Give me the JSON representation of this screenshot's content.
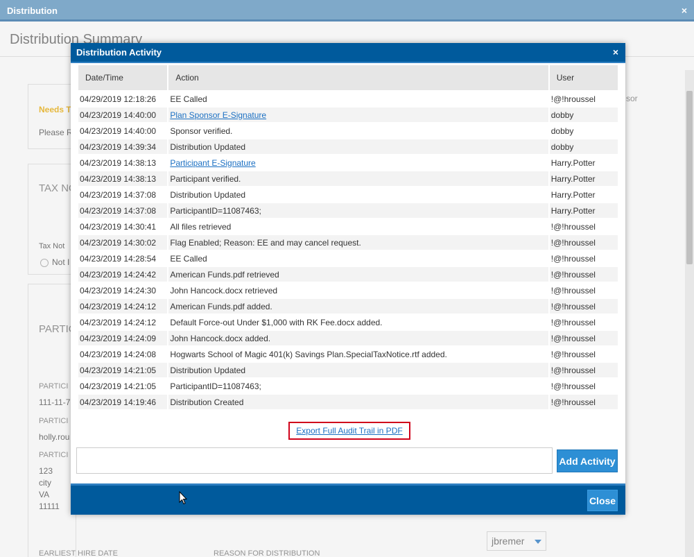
{
  "window": {
    "title": "Distribution",
    "close_icon": "×"
  },
  "background": {
    "summary_title": "Distribution Summary",
    "needs_text": "Needs T",
    "please_text": "Please R",
    "tax_notice_head": "TAX NO",
    "tax_notice_label": "Tax Not",
    "not_label": "Not I",
    "partic_head": "PARTIC",
    "partic_label_1": "PARTICI",
    "ssn_value": "111-11-7",
    "partic_label_2": "PARTICI",
    "email_value": "holly.rou",
    "partic_label_3": "PARTICI",
    "address_line1": "123",
    "address_line2": "city",
    "address_line3": "VA",
    "address_line4": "11111",
    "earliest_hire": "EARLIEST HIRE DATE",
    "reason_for": "REASON FOR DISTRIBUTION",
    "right_snippet": "sor",
    "assignee": "jbremer"
  },
  "modal": {
    "title": "Distribution Activity",
    "close_icon": "×",
    "columns": [
      "Date/Time",
      "Action",
      "User"
    ],
    "rows": [
      {
        "datetime": "04/29/2019 12:18:26",
        "action": "EE Called",
        "user": "!@!hroussel",
        "link": false
      },
      {
        "datetime": "04/23/2019 14:40:00",
        "action": "Plan Sponsor E-Signature",
        "user": "dobby",
        "link": true
      },
      {
        "datetime": "04/23/2019 14:40:00",
        "action": "Sponsor verified.",
        "user": "dobby",
        "link": false
      },
      {
        "datetime": "04/23/2019 14:39:34",
        "action": "Distribution Updated",
        "user": "dobby",
        "link": false
      },
      {
        "datetime": "04/23/2019 14:38:13",
        "action": "Participant E-Signature",
        "user": "Harry.Potter",
        "link": true
      },
      {
        "datetime": "04/23/2019 14:38:13",
        "action": "Participant verified.",
        "user": "Harry.Potter",
        "link": false
      },
      {
        "datetime": "04/23/2019 14:37:08",
        "action": "Distribution Updated",
        "user": "Harry.Potter",
        "link": false
      },
      {
        "datetime": "04/23/2019 14:37:08",
        "action": "ParticipantID=11087463;",
        "user": "Harry.Potter",
        "link": false
      },
      {
        "datetime": "04/23/2019 14:30:41",
        "action": "All files retrieved",
        "user": "!@!hroussel",
        "link": false
      },
      {
        "datetime": "04/23/2019 14:30:02",
        "action": "Flag Enabled; Reason: EE and may cancel request.",
        "user": "!@!hroussel",
        "link": false
      },
      {
        "datetime": "04/23/2019 14:28:54",
        "action": "EE Called",
        "user": "!@!hroussel",
        "link": false
      },
      {
        "datetime": "04/23/2019 14:24:42",
        "action": "American Funds.pdf retrieved",
        "user": "!@!hroussel",
        "link": false
      },
      {
        "datetime": "04/23/2019 14:24:30",
        "action": "John Hancock.docx retrieved",
        "user": "!@!hroussel",
        "link": false
      },
      {
        "datetime": "04/23/2019 14:24:12",
        "action": "American Funds.pdf added.",
        "user": "!@!hroussel",
        "link": false
      },
      {
        "datetime": "04/23/2019 14:24:12",
        "action": "Default Force-out Under $1,000 with RK Fee.docx added.",
        "user": "!@!hroussel",
        "link": false
      },
      {
        "datetime": "04/23/2019 14:24:09",
        "action": "John Hancock.docx added.",
        "user": "!@!hroussel",
        "link": false
      },
      {
        "datetime": "04/23/2019 14:24:08",
        "action": "Hogwarts School of Magic 401(k) Savings Plan.SpecialTaxNotice.rtf added.",
        "user": "!@!hroussel",
        "link": false
      },
      {
        "datetime": "04/23/2019 14:21:05",
        "action": "Distribution Updated",
        "user": "!@!hroussel",
        "link": false
      },
      {
        "datetime": "04/23/2019 14:21:05",
        "action": "ParticipantID=11087463;",
        "user": "!@!hroussel",
        "link": false
      },
      {
        "datetime": "04/23/2019 14:19:46",
        "action": "Distribution Created",
        "user": "!@!hroussel",
        "link": false
      }
    ],
    "export_label": "Export Full Audit Trail in PDF",
    "activity_input_value": "",
    "add_activity_label": "Add Activity",
    "close_label": "Close"
  },
  "colors": {
    "modal_header": "#005a9c",
    "outer_header": "#7fa9c9",
    "button": "#2d8fd5",
    "link": "#1a6fc2",
    "highlight_border": "#d0021b"
  }
}
